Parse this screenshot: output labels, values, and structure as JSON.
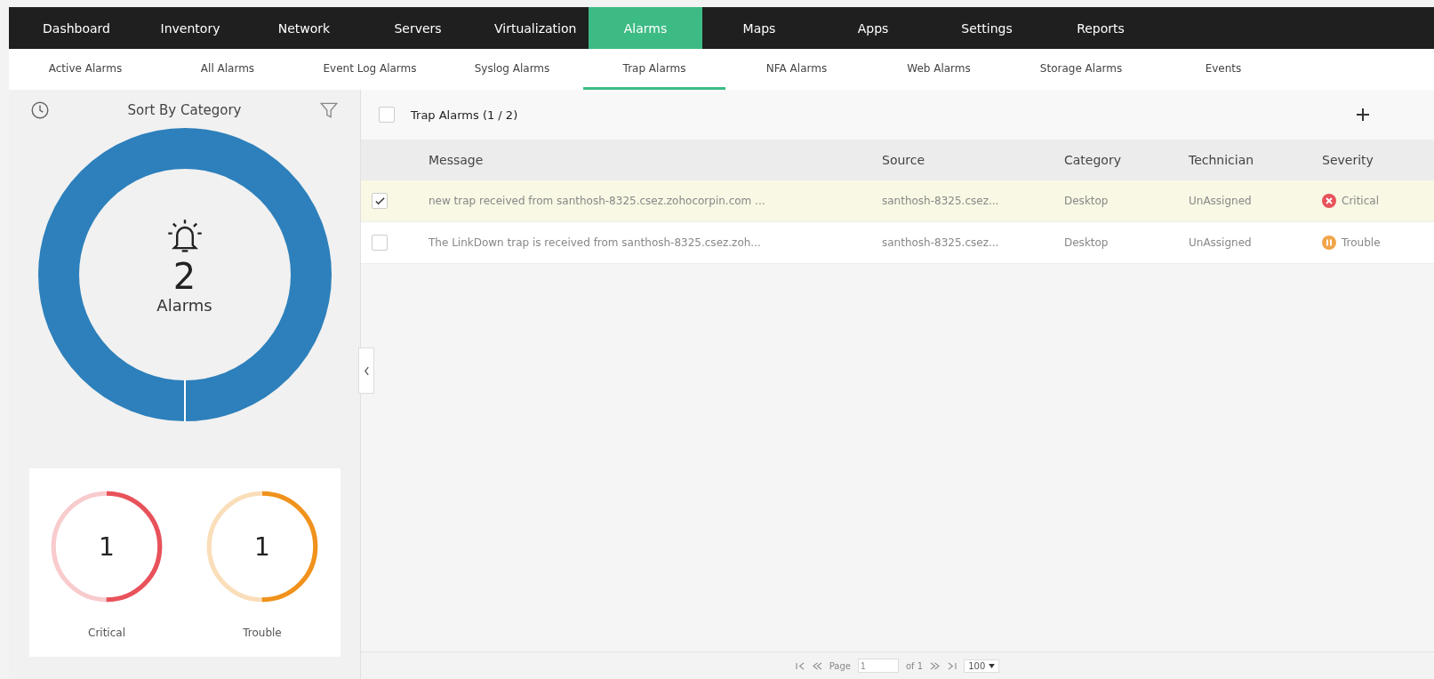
{
  "nav": [
    {
      "label": "Dashboard",
      "selected": false
    },
    {
      "label": "Inventory",
      "selected": false
    },
    {
      "label": "Network",
      "selected": false
    },
    {
      "label": "Servers",
      "selected": false
    },
    {
      "label": "Virtualization",
      "selected": false
    },
    {
      "label": "Alarms",
      "selected": true
    },
    {
      "label": "Maps",
      "selected": false
    },
    {
      "label": "Apps",
      "selected": false
    },
    {
      "label": "Settings",
      "selected": false
    },
    {
      "label": "Reports",
      "selected": false
    }
  ],
  "subnav": [
    {
      "label": "Active Alarms",
      "selected": false
    },
    {
      "label": "All Alarms",
      "selected": false
    },
    {
      "label": "Event Log Alarms",
      "selected": false
    },
    {
      "label": "Syslog Alarms",
      "selected": false
    },
    {
      "label": "Trap Alarms",
      "selected": true
    },
    {
      "label": "NFA Alarms",
      "selected": false
    },
    {
      "label": "Web Alarms",
      "selected": false
    },
    {
      "label": "Storage Alarms",
      "selected": false
    },
    {
      "label": "Events",
      "selected": false
    }
  ],
  "sidebar": {
    "sort_label": "Sort By Category",
    "total": "2",
    "total_label": "Alarms",
    "gauges": [
      {
        "count": "1",
        "label": "Critical",
        "color": "#e8525a",
        "level": 0.5
      },
      {
        "count": "1",
        "label": "Trouble",
        "color": "#f0921b",
        "level": 0.5
      }
    ]
  },
  "table": {
    "title": "Trap Alarms (1 / 2)",
    "select_all": false,
    "columns": [
      "Message",
      "Source",
      "Category",
      "Technician",
      "Severity"
    ],
    "rows": [
      {
        "selected": true,
        "message": "new trap received from santhosh-8325.csez.zohocorpin.com ...",
        "source": "santhosh-8325.csez...",
        "category": "Desktop",
        "technician": "UnAssigned",
        "severity": "Critical",
        "kind": "critical"
      },
      {
        "selected": false,
        "message": "The LinkDown trap is received from santhosh-8325.csez.zoh...",
        "source": "santhosh-8325.csez...",
        "category": "Desktop",
        "technician": "UnAssigned",
        "severity": "Trouble",
        "kind": "trouble"
      }
    ]
  },
  "pager": {
    "page_label": "Page",
    "page": "1",
    "of": "of 1",
    "per_page": "100"
  }
}
